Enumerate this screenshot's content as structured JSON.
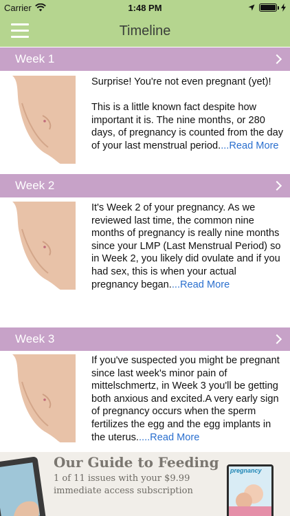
{
  "status": {
    "carrier": "Carrier",
    "time": "1:48 PM",
    "battery_level": 1.0,
    "icons": [
      "wifi-icon",
      "location-arrow-icon",
      "battery-icon",
      "charging-bolt-icon"
    ]
  },
  "navbar": {
    "title": "Timeline",
    "menu_icon": "hamburger-menu-icon"
  },
  "colors": {
    "navbar": "#b5d58f",
    "week_header": "#c7a2c8",
    "link": "#2a6fce"
  },
  "weeks": [
    {
      "label": "Week 1",
      "paragraphs": [
        "Surprise! You're not even pregnant (yet)!",
        "This is a little known fact despite how important it is. The nine months, or 280 days, of pregnancy is counted from the day of your last menstrual period."
      ],
      "read_more": "...Read More"
    },
    {
      "label": "Week 2",
      "paragraphs": [
        "It's Week 2 of your pregnancy. As we reviewed last time, the common nine months of pregnancy is really nine months since your LMP  (Last Menstrual Period) so in Week 2, you likely did ovulate and if you had sex, this is when your actual pregnancy began."
      ],
      "read_more": "...Read More"
    },
    {
      "label": "Week 3",
      "paragraphs": [
        "If you've suspected you might be pregnant since last week's minor pain of mittelschmertz, in Week 3 you'll be getting both anxious and excited.A very early sign of pregnancy occurs when the sperm fertilizes the egg and the egg implants in the uterus."
      ],
      "read_more": "....Read More"
    }
  ],
  "ad": {
    "title": "Our Guide to Feeding",
    "line1": "1 of 11 issues with your $9.99",
    "line2": "immediate access subscription",
    "magazine_title": "pregnancy"
  }
}
